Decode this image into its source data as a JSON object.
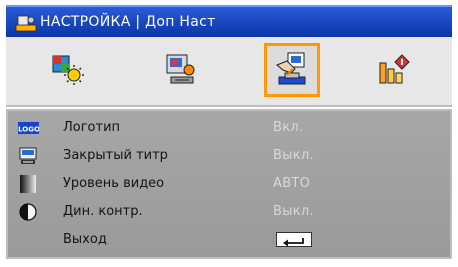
{
  "window": {
    "title": "НАСТРОЙКА | Доп Наст",
    "title_icon": "projector-setup-icon"
  },
  "tabs": [
    {
      "icon": "image-settings-icon",
      "active": false
    },
    {
      "icon": "display-settings-icon",
      "active": false
    },
    {
      "icon": "setup-hand-icon",
      "active": true
    },
    {
      "icon": "options-info-icon",
      "active": false
    }
  ],
  "menu": {
    "items": [
      {
        "label": "Логотип",
        "value": "Вкл.",
        "icon": "logo-badge-icon"
      },
      {
        "label": "Закрытый титр",
        "value": "Выкл.",
        "icon": "closed-caption-icon"
      },
      {
        "label": "Уровень видео",
        "value": "АВТО",
        "icon": "video-level-icon"
      },
      {
        "label": "Дин. контр.",
        "value": "Выкл.",
        "icon": "contrast-circle-icon"
      },
      {
        "label": "Выход",
        "value": "",
        "icon": "enter-key-icon"
      }
    ]
  },
  "logo_badge_text": "LOGO",
  "colors": {
    "title_bar": "#1f4fd0",
    "tab_highlight": "#ff9900",
    "menu_bg": "#a3a3a3",
    "value_text": "#d9d9d9"
  }
}
